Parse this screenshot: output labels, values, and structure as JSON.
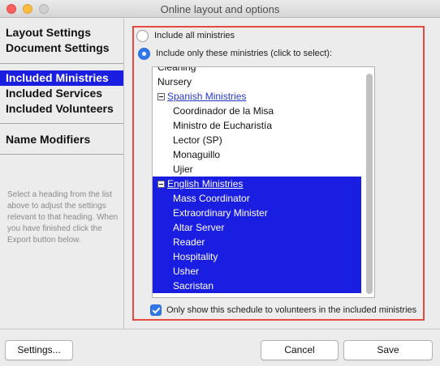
{
  "window": {
    "title": "Online layout and options"
  },
  "sidebar": {
    "items": [
      {
        "label": "Layout Settings"
      },
      {
        "label": "Document Settings"
      },
      {
        "label": "Included Ministries",
        "selected": true
      },
      {
        "label": "Included Services"
      },
      {
        "label": "Included Volunteers"
      },
      {
        "label": "Name Modifiers"
      }
    ],
    "hint": "Select a heading from the list above to adjust the settings relevant to that heading. When you have finished click the Export button below."
  },
  "options": {
    "include_all_label": "Include all ministries",
    "include_only_label": "Include only these ministries (click to select):",
    "selected_option": "include_only"
  },
  "ministries": {
    "rows": [
      {
        "label": "Cleaning",
        "level": 0,
        "selected": false
      },
      {
        "label": "Nursery",
        "level": 0,
        "selected": false
      },
      {
        "label": "Spanish Ministries",
        "level": 0,
        "group": true,
        "selected": false
      },
      {
        "label": "Coordinador de la Misa",
        "level": 1,
        "selected": false
      },
      {
        "label": "Ministro de Eucharistía",
        "level": 1,
        "selected": false
      },
      {
        "label": "Lector (SP)",
        "level": 1,
        "selected": false
      },
      {
        "label": "Monaguillo",
        "level": 1,
        "selected": false
      },
      {
        "label": "Ujier",
        "level": 1,
        "selected": false
      },
      {
        "label": "English Ministries",
        "level": 0,
        "group": true,
        "selected": true
      },
      {
        "label": "Mass Coordinator",
        "level": 1,
        "selected": true
      },
      {
        "label": "Extraordinary Minister",
        "level": 1,
        "selected": true
      },
      {
        "label": "Altar Server",
        "level": 1,
        "selected": true
      },
      {
        "label": "Reader",
        "level": 1,
        "selected": true
      },
      {
        "label": "Hospitality",
        "level": 1,
        "selected": true
      },
      {
        "label": "Usher",
        "level": 1,
        "selected": true
      },
      {
        "label": "Sacristan",
        "level": 1,
        "selected": true
      }
    ]
  },
  "schedule_option": {
    "label": "Only show this schedule to volunteers in the included ministries",
    "checked": true
  },
  "footer": {
    "settings_label": "Settings...",
    "cancel_label": "Cancel",
    "save_label": "Save"
  },
  "colors": {
    "selection": "#1a1ee0",
    "highlight_border": "#e64940",
    "accent": "#2f77ea"
  }
}
